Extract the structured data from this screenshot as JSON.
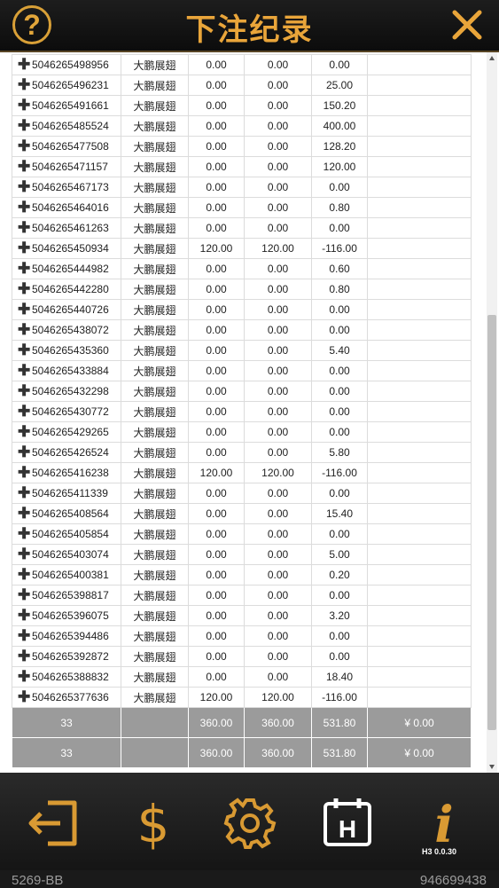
{
  "header": {
    "title": "下注纪录",
    "help_label": "?"
  },
  "rows": [
    {
      "id": "5046265498956",
      "game": "大鹏展翅",
      "bet": "0.00",
      "valid": "0.00",
      "win": "0.00",
      "neg": false
    },
    {
      "id": "5046265496231",
      "game": "大鹏展翅",
      "bet": "0.00",
      "valid": "0.00",
      "win": "25.00",
      "neg": false
    },
    {
      "id": "5046265491661",
      "game": "大鹏展翅",
      "bet": "0.00",
      "valid": "0.00",
      "win": "150.20",
      "neg": false
    },
    {
      "id": "5046265485524",
      "game": "大鹏展翅",
      "bet": "0.00",
      "valid": "0.00",
      "win": "400.00",
      "neg": false
    },
    {
      "id": "5046265477508",
      "game": "大鹏展翅",
      "bet": "0.00",
      "valid": "0.00",
      "win": "128.20",
      "neg": false
    },
    {
      "id": "5046265471157",
      "game": "大鹏展翅",
      "bet": "0.00",
      "valid": "0.00",
      "win": "120.00",
      "neg": false
    },
    {
      "id": "5046265467173",
      "game": "大鹏展翅",
      "bet": "0.00",
      "valid": "0.00",
      "win": "0.00",
      "neg": false
    },
    {
      "id": "5046265464016",
      "game": "大鹏展翅",
      "bet": "0.00",
      "valid": "0.00",
      "win": "0.80",
      "neg": false
    },
    {
      "id": "5046265461263",
      "game": "大鹏展翅",
      "bet": "0.00",
      "valid": "0.00",
      "win": "0.00",
      "neg": false
    },
    {
      "id": "5046265450934",
      "game": "大鹏展翅",
      "bet": "120.00",
      "valid": "120.00",
      "win": "-116.00",
      "neg": true
    },
    {
      "id": "5046265444982",
      "game": "大鹏展翅",
      "bet": "0.00",
      "valid": "0.00",
      "win": "0.60",
      "neg": false
    },
    {
      "id": "5046265442280",
      "game": "大鹏展翅",
      "bet": "0.00",
      "valid": "0.00",
      "win": "0.80",
      "neg": false
    },
    {
      "id": "5046265440726",
      "game": "大鹏展翅",
      "bet": "0.00",
      "valid": "0.00",
      "win": "0.00",
      "neg": false
    },
    {
      "id": "5046265438072",
      "game": "大鹏展翅",
      "bet": "0.00",
      "valid": "0.00",
      "win": "0.00",
      "neg": false
    },
    {
      "id": "5046265435360",
      "game": "大鹏展翅",
      "bet": "0.00",
      "valid": "0.00",
      "win": "5.40",
      "neg": false
    },
    {
      "id": "5046265433884",
      "game": "大鹏展翅",
      "bet": "0.00",
      "valid": "0.00",
      "win": "0.00",
      "neg": false
    },
    {
      "id": "5046265432298",
      "game": "大鹏展翅",
      "bet": "0.00",
      "valid": "0.00",
      "win": "0.00",
      "neg": false
    },
    {
      "id": "5046265430772",
      "game": "大鹏展翅",
      "bet": "0.00",
      "valid": "0.00",
      "win": "0.00",
      "neg": false
    },
    {
      "id": "5046265429265",
      "game": "大鹏展翅",
      "bet": "0.00",
      "valid": "0.00",
      "win": "0.00",
      "neg": false
    },
    {
      "id": "5046265426524",
      "game": "大鹏展翅",
      "bet": "0.00",
      "valid": "0.00",
      "win": "5.80",
      "neg": false
    },
    {
      "id": "5046265416238",
      "game": "大鹏展翅",
      "bet": "120.00",
      "valid": "120.00",
      "win": "-116.00",
      "neg": true
    },
    {
      "id": "5046265411339",
      "game": "大鹏展翅",
      "bet": "0.00",
      "valid": "0.00",
      "win": "0.00",
      "neg": false
    },
    {
      "id": "5046265408564",
      "game": "大鹏展翅",
      "bet": "0.00",
      "valid": "0.00",
      "win": "15.40",
      "neg": false
    },
    {
      "id": "5046265405854",
      "game": "大鹏展翅",
      "bet": "0.00",
      "valid": "0.00",
      "win": "0.00",
      "neg": false
    },
    {
      "id": "5046265403074",
      "game": "大鹏展翅",
      "bet": "0.00",
      "valid": "0.00",
      "win": "5.00",
      "neg": false
    },
    {
      "id": "5046265400381",
      "game": "大鹏展翅",
      "bet": "0.00",
      "valid": "0.00",
      "win": "0.20",
      "neg": false
    },
    {
      "id": "5046265398817",
      "game": "大鹏展翅",
      "bet": "0.00",
      "valid": "0.00",
      "win": "0.00",
      "neg": false
    },
    {
      "id": "5046265396075",
      "game": "大鹏展翅",
      "bet": "0.00",
      "valid": "0.00",
      "win": "3.20",
      "neg": false
    },
    {
      "id": "5046265394486",
      "game": "大鹏展翅",
      "bet": "0.00",
      "valid": "0.00",
      "win": "0.00",
      "neg": false
    },
    {
      "id": "5046265392872",
      "game": "大鹏展翅",
      "bet": "0.00",
      "valid": "0.00",
      "win": "0.00",
      "neg": false
    },
    {
      "id": "5046265388832",
      "game": "大鹏展翅",
      "bet": "0.00",
      "valid": "0.00",
      "win": "18.40",
      "neg": false
    },
    {
      "id": "5046265377636",
      "game": "大鹏展翅",
      "bet": "120.00",
      "valid": "120.00",
      "win": "-116.00",
      "neg": true
    }
  ],
  "summary": [
    {
      "count": "33",
      "game": "",
      "bet": "360.00",
      "valid": "360.00",
      "win": "531.80",
      "balance": "¥ 0.00"
    },
    {
      "count": "33",
      "game": "",
      "bet": "360.00",
      "valid": "360.00",
      "win": "531.80",
      "balance": "¥ 0.00"
    }
  ],
  "footer": {
    "icons": [
      "exit-icon",
      "dollar-icon",
      "gear-icon",
      "history-icon",
      "info-icon"
    ],
    "version": "H3 0.0.30",
    "bottom_left": "5269-BB",
    "bottom_right": "946699438"
  },
  "colors": {
    "accent": "#e9a53a",
    "positive": "#2f6fd8",
    "negative": "#e0202a",
    "summary_bg": "#9b9b9b"
  }
}
